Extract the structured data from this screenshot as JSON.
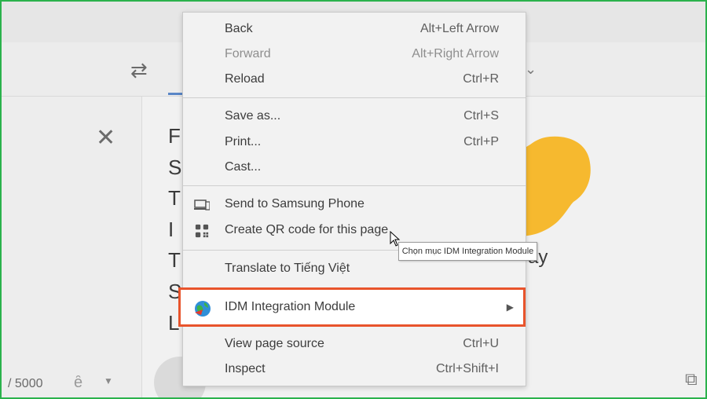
{
  "background": {
    "char_count": "/ 5000",
    "text_letters": [
      "F",
      "S",
      "T",
      "I",
      "T",
      "S",
      "L"
    ],
    "text_tail": "ay"
  },
  "menu": {
    "items": [
      {
        "label": "Back",
        "shortcut": "Alt+Left Arrow"
      },
      {
        "label": "Forward",
        "shortcut": "Alt+Right Arrow"
      },
      {
        "label": "Reload",
        "shortcut": "Ctrl+R"
      },
      {
        "label": "Save as...",
        "shortcut": "Ctrl+S"
      },
      {
        "label": "Print...",
        "shortcut": "Ctrl+P"
      },
      {
        "label": "Cast...",
        "shortcut": ""
      },
      {
        "label": "Send to Samsung Phone",
        "shortcut": ""
      },
      {
        "label": "Create QR code for this page",
        "shortcut": ""
      },
      {
        "label": "Translate to Tiếng Việt",
        "shortcut": ""
      },
      {
        "label": "IDM Integration Module",
        "shortcut": ""
      },
      {
        "label": "View page source",
        "shortcut": "Ctrl+U"
      },
      {
        "label": "Inspect",
        "shortcut": "Ctrl+Shift+I"
      }
    ]
  },
  "tooltip": "Chọn mục IDM Integration Module",
  "colors": {
    "highlight_border": "#e8542c",
    "frame_border": "#2bb24c",
    "hand": "#f6b92f"
  }
}
